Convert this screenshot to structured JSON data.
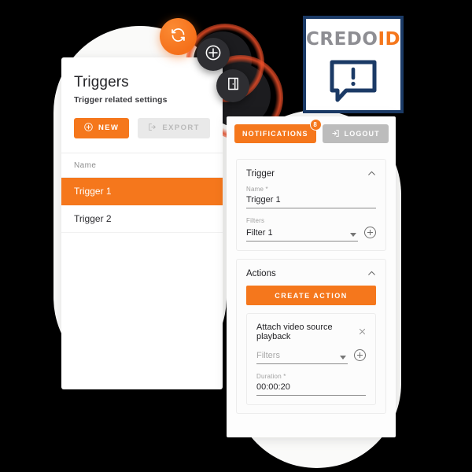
{
  "left_panel": {
    "title": "Triggers",
    "subtitle": "Trigger related settings",
    "buttons": [
      {
        "label": "NEW",
        "icon": "plus-circle-icon",
        "style": "primary"
      },
      {
        "label": "EXPORT",
        "icon": "export-icon",
        "style": "muted"
      }
    ],
    "table": {
      "columns": [
        "Name"
      ],
      "rows": [
        {
          "name": "Trigger 1",
          "selected": true
        },
        {
          "name": "Trigger 2",
          "selected": false
        }
      ]
    }
  },
  "floating_buttons": [
    {
      "icon": "refresh-icon",
      "color": "#f5771c"
    },
    {
      "icon": "plus-icon",
      "color": "#2e2e32"
    },
    {
      "icon": "door-icon",
      "color": "#2e2e32"
    }
  ],
  "logo_card": {
    "word_gray": "CREDO",
    "word_orange": "ID",
    "icon": "alert-speech-bubble-icon",
    "bubble_text": "!",
    "border_color": "#1b3a66",
    "gray_color": "#8e8e93",
    "orange_color": "#f5771c"
  },
  "right_panel": {
    "topbar": {
      "notifications_label": "NOTIFICATIONS",
      "notifications_count": "8",
      "logout_label": "LOGOUT",
      "logout_icon": "logout-icon"
    },
    "trigger_section": {
      "heading": "Trigger",
      "collapse_icon": "chevron-up-icon",
      "name_label": "Name *",
      "name_value": "Trigger 1",
      "filters_label": "Filters",
      "filters_value": "Filter 1",
      "add_icon": "plus-circle-icon"
    },
    "actions_section": {
      "heading": "Actions",
      "collapse_icon": "chevron-up-icon",
      "create_label": "CREATE ACTION",
      "action": {
        "title": "Attach video source playback",
        "close_icon": "close-icon",
        "filters_label": "Filters",
        "filters_placeholder": "Filters",
        "add_icon": "plus-circle-icon",
        "duration_label": "Duration *",
        "duration_value": "00:00:20"
      }
    }
  },
  "theme": {
    "accent": "#f5771c",
    "dark": "#2e2e32",
    "navy": "#1b3a66",
    "muted": "#e9e9e9"
  }
}
